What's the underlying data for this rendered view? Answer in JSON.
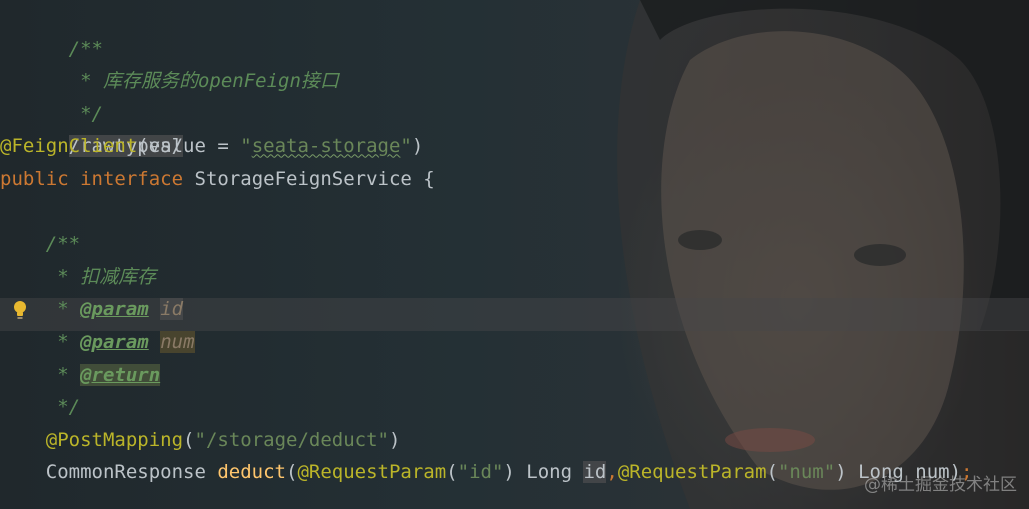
{
  "editor": {
    "lines": [
      {
        "id": "doc-open",
        "text": "/**"
      },
      {
        "id": "doc-desc",
        "text": " * 库存服务的openFeign接口"
      },
      {
        "id": "doc-close",
        "text": " */"
      },
      {
        "id": "rawtypes",
        "text": "/rawtypes/"
      },
      {
        "id": "feign-client",
        "annotation": "@FeignClient",
        "open": "(value = ",
        "string_quote_open": "\"",
        "string_value": "seata-storage",
        "string_quote_close": "\"",
        "close": ")"
      },
      {
        "id": "interface-decl",
        "kw1": "public",
        "kw2": "interface",
        "name": "StorageFeignService {"
      },
      {
        "id": "blank",
        "text": ""
      },
      {
        "id": "m-doc-open",
        "text": "/**"
      },
      {
        "id": "m-doc-desc",
        "prefix": " * ",
        "text": "扣减库存"
      },
      {
        "id": "m-doc-param-id",
        "prefix": " * ",
        "tag": "@param",
        "value": "id"
      },
      {
        "id": "m-doc-param-num",
        "prefix": " * ",
        "tag": "@param",
        "value": "num"
      },
      {
        "id": "m-doc-return",
        "prefix": " * ",
        "tag": "@return"
      },
      {
        "id": "m-doc-close",
        "text": " */"
      },
      {
        "id": "post-mapping",
        "annotation": "@PostMapping",
        "open": "(",
        "string": "\"/storage/deduct\"",
        "close": ")"
      },
      {
        "id": "method-sig",
        "type": "CommonResponse ",
        "name": "deduct",
        "p1": "(",
        "ann1": "@RequestParam",
        "a1open": "(",
        "s1": "\"id\"",
        "a1close": ") Long ",
        "param1": "id",
        "comma": ",",
        "ann2": "@RequestParam",
        "a2open": "(",
        "s2": "\"num\"",
        "a2close": ") Long num)",
        "semicolon": ";"
      }
    ]
  },
  "watermark": "@稀土掘金技术社区",
  "colors": {
    "keyword": "#cc7832",
    "annotation": "#bbb529",
    "string": "#6a8759",
    "doc_comment": "#5c8b58",
    "method_name": "#ffc66d"
  },
  "icons": {
    "gutter": "lightbulb-icon"
  }
}
